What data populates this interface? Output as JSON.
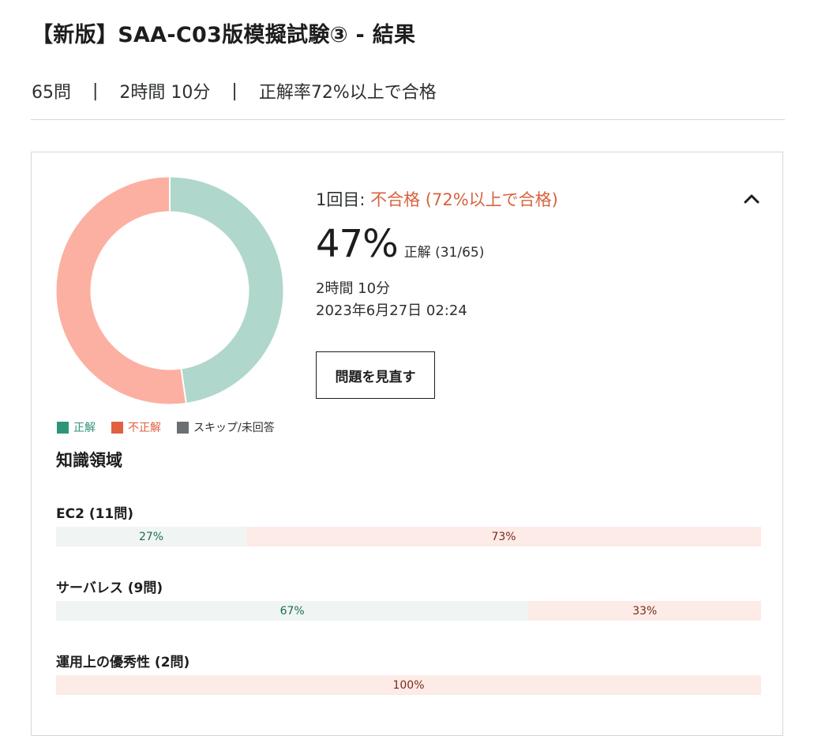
{
  "header": {
    "title": "【新版】SAA-C03版模擬試験③ - 結果",
    "questions": "65問",
    "separator": "|",
    "time_limit": "2時間 10分",
    "pass_rule": "正解率72%以上で合格"
  },
  "result": {
    "attempt_label": "1回目:",
    "status": "不合格 (72%以上で合格)",
    "score_percent": "47%",
    "score_detail": "正解 (31/65)",
    "duration": "2時間 10分",
    "date": "2023年6月27日 02:24",
    "review_button": "問題を見直す",
    "collapse_icon": "chevron-up-icon"
  },
  "chart_data": {
    "type": "pie",
    "subtype": "donut",
    "labels": [
      "正解",
      "不正解",
      "スキップ/未回答"
    ],
    "values": [
      31,
      34,
      0
    ],
    "colors": [
      "#b0d7cc",
      "#fcb0a2",
      "#6a6f73"
    ]
  },
  "legend": [
    {
      "label": "正解",
      "swatch": "#2e9477",
      "text_color": "#2e9477"
    },
    {
      "label": "不正解",
      "swatch": "#e0603f",
      "text_color": "#e0603f"
    },
    {
      "label": "スキップ/未回答",
      "swatch": "#6a6f73",
      "text_color": "#2d2f31"
    }
  ],
  "knowledge": {
    "title": "知識領域",
    "domains": [
      {
        "name": "EC2 (11問)",
        "correct": 27,
        "correct_label": "27%",
        "incorrect": 73,
        "incorrect_label": "73%"
      },
      {
        "name": "サーバレス (9問)",
        "correct": 67,
        "correct_label": "67%",
        "incorrect": 33,
        "incorrect_label": "33%"
      },
      {
        "name": "運用上の優秀性 (2問)",
        "correct": 0,
        "correct_label": "",
        "incorrect": 100,
        "incorrect_label": "100%"
      }
    ]
  },
  "colors": {
    "fail_text": "#d9623f",
    "correct_bar_bg": "#f0f5f3",
    "incorrect_bar_bg": "#fcebe7",
    "border": "#d1d7dc"
  }
}
